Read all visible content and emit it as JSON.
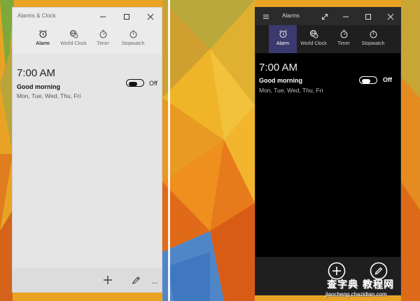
{
  "light_window": {
    "title": "Alarms & Clock",
    "tabs": [
      {
        "label": "Alarm",
        "icon": "alarm-clock-icon",
        "active": true
      },
      {
        "label": "World Clock",
        "icon": "globe-clock-icon",
        "active": false
      },
      {
        "label": "Timer",
        "icon": "timer-icon",
        "active": false
      },
      {
        "label": "Stopwatch",
        "icon": "stopwatch-icon",
        "active": false
      }
    ],
    "alarm": {
      "time": "7:00 AM",
      "name": "Good morning",
      "days": "Mon, Tue, Wed, Thu, Fri",
      "state": "Off"
    },
    "commands": [
      "add-icon",
      "edit-pencil-icon",
      "more-icon"
    ],
    "more_label": "..."
  },
  "dark_window": {
    "title": "Alarms",
    "tabs": [
      {
        "label": "Alarm",
        "icon": "alarm-clock-icon",
        "active": true
      },
      {
        "label": "World Clock",
        "icon": "globe-clock-icon",
        "active": false
      },
      {
        "label": "Timer",
        "icon": "timer-icon",
        "active": false
      },
      {
        "label": "Stopwatch",
        "icon": "stopwatch-icon",
        "active": false
      }
    ],
    "alarm": {
      "time": "7:00 AM",
      "name": "Good morning",
      "days": "Mon, Tue, Wed, Thu, Fri",
      "state": "Off"
    },
    "commands": [
      "add-circle-icon",
      "edit-circle-icon"
    ]
  },
  "watermark": {
    "line1": "查字典 教程网",
    "line2": "jiaocheng.chazidian.com"
  },
  "colors": {
    "dark_accent": "#3a3a6e",
    "wallpaper_main": "#e8a020"
  }
}
